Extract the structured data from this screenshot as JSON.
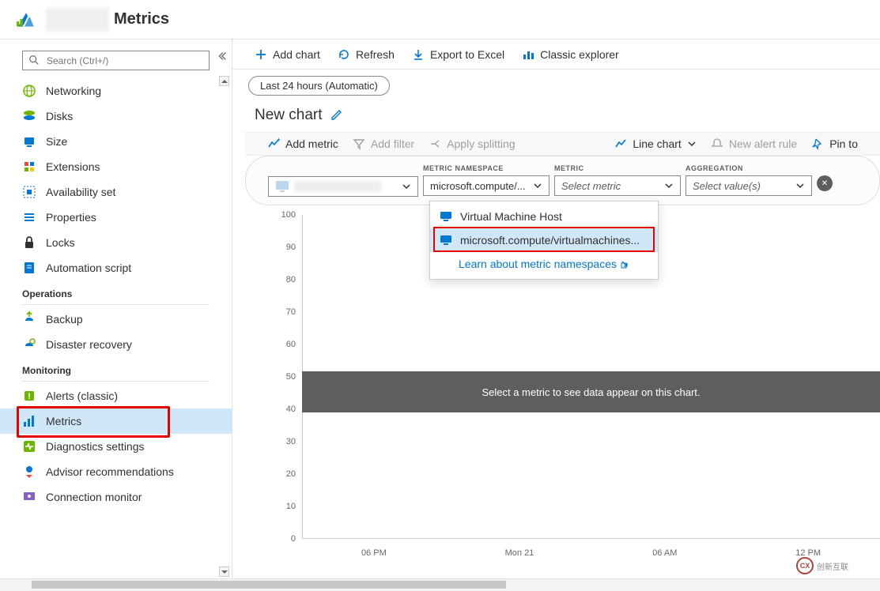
{
  "header": {
    "title_suffix": "Metrics"
  },
  "sidebar": {
    "search_placeholder": "Search (Ctrl+/)",
    "items_top": [
      {
        "icon": "network",
        "label": "Networking"
      },
      {
        "icon": "disks",
        "label": "Disks"
      },
      {
        "icon": "size",
        "label": "Size"
      },
      {
        "icon": "extensions",
        "label": "Extensions"
      },
      {
        "icon": "avset",
        "label": "Availability set"
      },
      {
        "icon": "props",
        "label": "Properties"
      },
      {
        "icon": "locks",
        "label": "Locks"
      },
      {
        "icon": "script",
        "label": "Automation script"
      }
    ],
    "section_ops": "Operations",
    "items_ops": [
      {
        "icon": "backup",
        "label": "Backup"
      },
      {
        "icon": "dr",
        "label": "Disaster recovery"
      }
    ],
    "section_mon": "Monitoring",
    "items_mon": [
      {
        "icon": "alerts",
        "label": "Alerts (classic)"
      },
      {
        "icon": "metrics",
        "label": "Metrics",
        "active": true,
        "highlight": true
      },
      {
        "icon": "diag",
        "label": "Diagnostics settings"
      },
      {
        "icon": "advisor",
        "label": "Advisor recommendations"
      },
      {
        "icon": "connmon",
        "label": "Connection monitor"
      }
    ]
  },
  "toolbar": {
    "addchart": "Add chart",
    "refresh": "Refresh",
    "export": "Export to Excel",
    "classic": "Classic explorer"
  },
  "timerange": "Last 24 hours (Automatic)",
  "chart_title": "New chart",
  "chart_toolbar": {
    "addmetric": "Add metric",
    "addfilter": "Add filter",
    "applysplit": "Apply splitting",
    "linechart": "Line chart",
    "alertrule": "New alert rule",
    "pin": "Pin to"
  },
  "selectors": {
    "ns_label": "METRIC NAMESPACE",
    "ns_value": "microsoft.compute/...",
    "metric_label": "METRIC",
    "metric_placeholder": "Select metric",
    "agg_label": "AGGREGATION",
    "agg_placeholder": "Select value(s)"
  },
  "dropdown": {
    "opt1": "Virtual Machine Host",
    "opt2": "microsoft.compute/virtualmachines...",
    "link": "Learn about metric namespaces"
  },
  "chart_data": {
    "type": "line",
    "title": "",
    "series": [],
    "y_ticks": [
      100,
      90,
      80,
      70,
      60,
      50,
      40,
      30,
      20,
      10,
      0
    ],
    "x_ticks": [
      "06 PM",
      "Mon 21",
      "06 AM",
      "12 PM"
    ],
    "ylim": [
      0,
      100
    ],
    "xlabel": "",
    "ylabel": "",
    "empty_message": "Select a metric to see data appear on this chart."
  },
  "watermark": "创新互联"
}
